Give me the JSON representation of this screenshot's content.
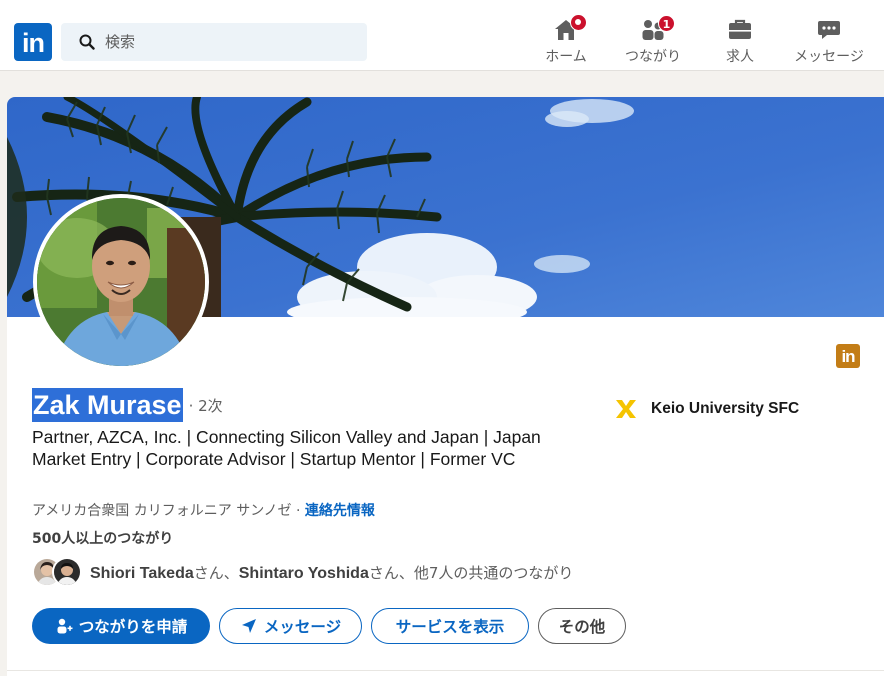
{
  "nav": {
    "logo_text": "in",
    "search": {
      "placeholder": "検索"
    },
    "items": [
      {
        "label": "ホーム",
        "icon": "home-icon",
        "badge": ""
      },
      {
        "label": "つながり",
        "icon": "network-icon",
        "badge": "1"
      },
      {
        "label": "求人",
        "icon": "jobs-icon",
        "badge": ""
      },
      {
        "label": "メッセージ",
        "icon": "messaging-icon",
        "badge": ""
      }
    ]
  },
  "profile": {
    "name": "Zak Murase",
    "degree": "· 2次",
    "headline": "Partner, AZCA, Inc. | Connecting Silicon Valley and Japan | Japan Market Entry | Corporate Advisor | Startup Mentor | Former VC",
    "school": "Keio University SFC",
    "location": "アメリカ合衆国 カリフォルニア サンノゼ · ",
    "contact_link": "連絡先情報",
    "connections": "500人以上のつながり",
    "mutual": {
      "name1": "Shiori Takeda",
      "sep1": "さん、",
      "name2": "Shintaro Yoshida",
      "rest": "さん、他7人の共通のつながり"
    },
    "mini_logo_text": "in"
  },
  "actions": {
    "connect": "つながりを申請",
    "message": "メッセージ",
    "services": "サービスを表示",
    "more": "その他"
  },
  "colors": {
    "brand": "#0a66c2",
    "badge": "#cb112d",
    "name_highlight": "#2e6fd8",
    "keio_yellow": "#f5c400"
  }
}
